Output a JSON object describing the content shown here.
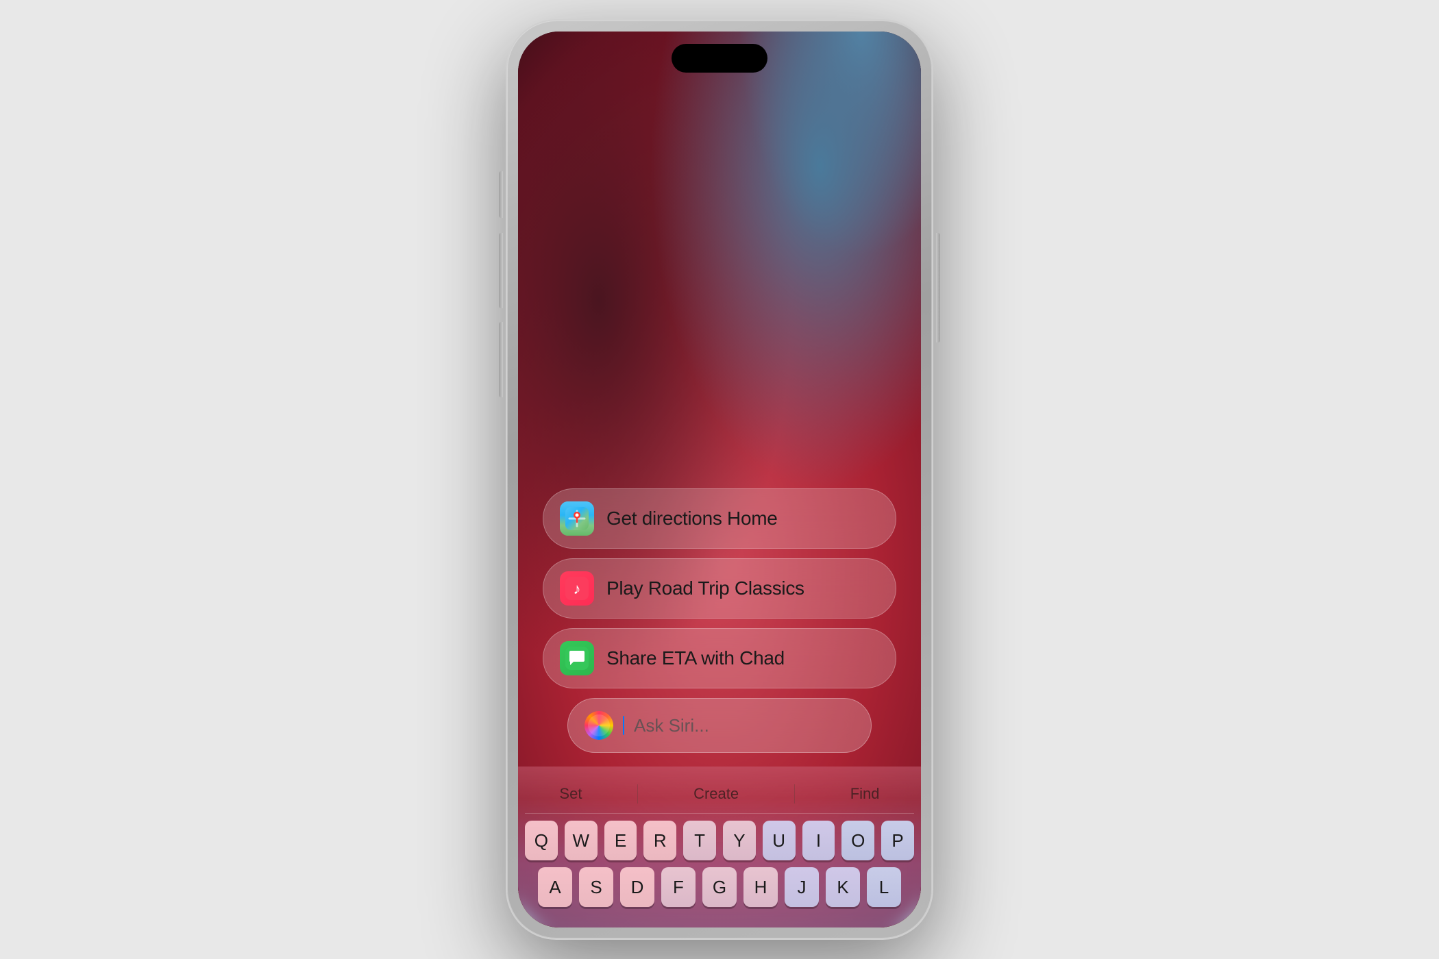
{
  "phone": {
    "dynamic_island": "Dynamic Island"
  },
  "suggestions": [
    {
      "id": "directions",
      "icon_type": "maps",
      "icon_label": "Maps icon",
      "text": "Get directions Home"
    },
    {
      "id": "music",
      "icon_type": "music",
      "icon_label": "Music icon",
      "text": "Play Road Trip Classics"
    },
    {
      "id": "messages",
      "icon_type": "messages",
      "icon_label": "Messages icon",
      "text": "Share ETA with Chad"
    }
  ],
  "siri_bar": {
    "placeholder": "Ask Siri..."
  },
  "keyboard": {
    "shortcuts": [
      "Set",
      "Create",
      "Find"
    ],
    "row1": [
      "Q",
      "W",
      "E",
      "R",
      "T",
      "Y",
      "U",
      "I",
      "O",
      "P"
    ],
    "row2": [
      "A",
      "S",
      "D",
      "F",
      "G",
      "H",
      "J",
      "K",
      "L"
    ]
  }
}
